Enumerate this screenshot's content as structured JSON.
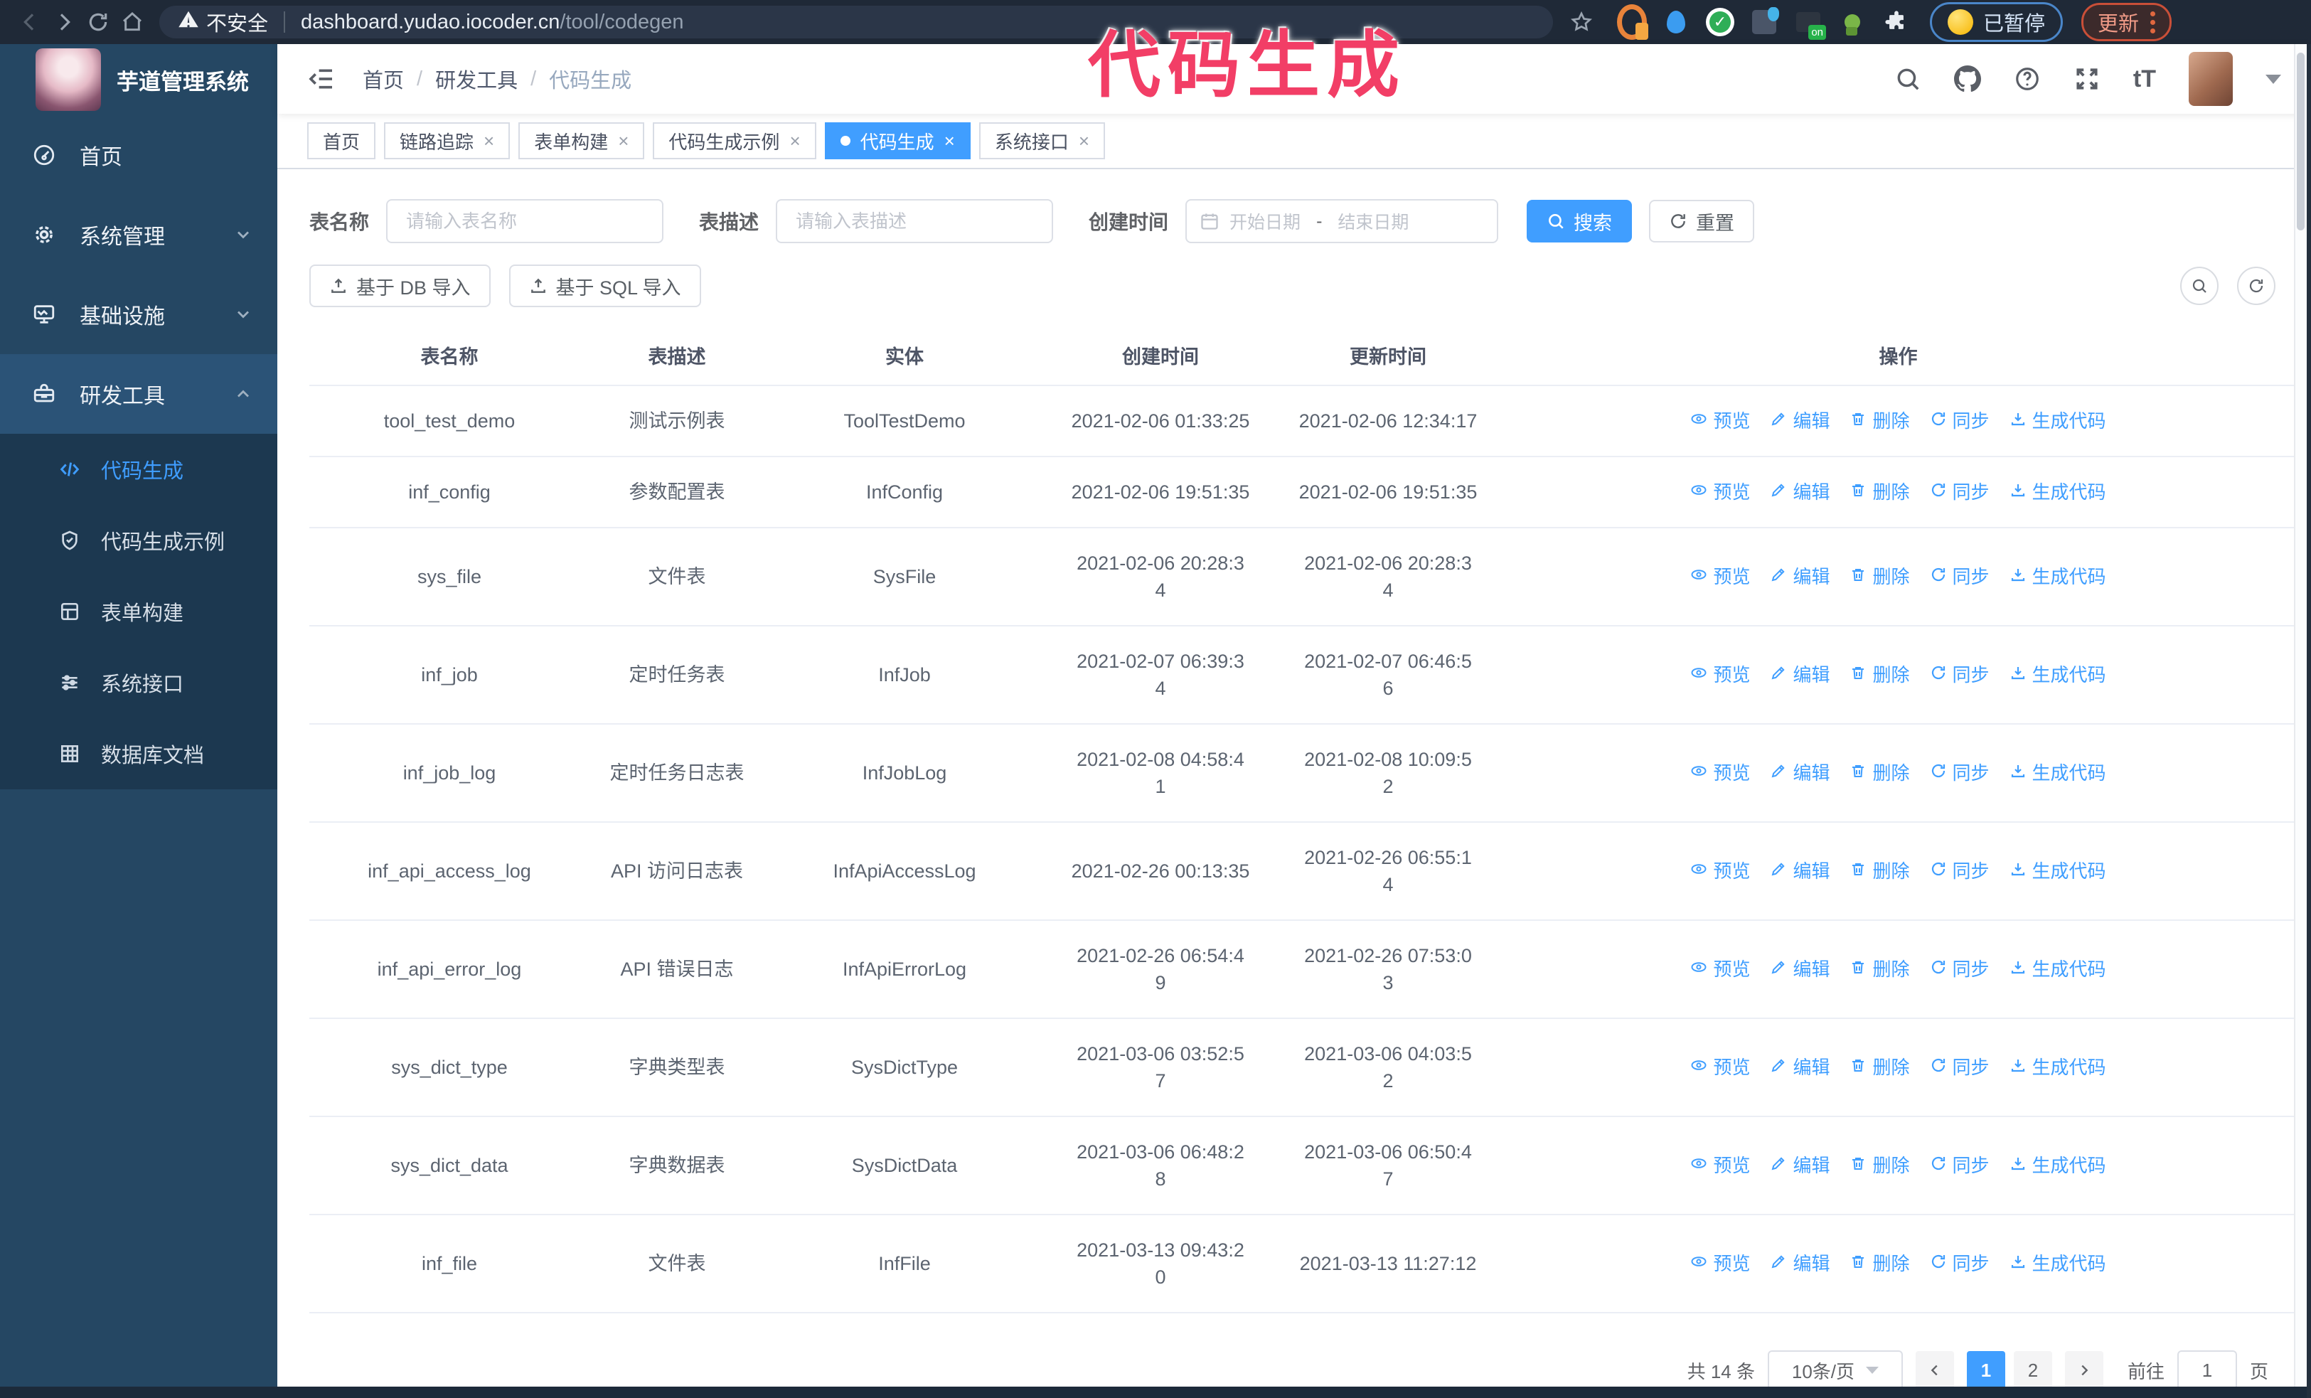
{
  "theme": {
    "accent": "#409EFF",
    "annotation_pink": "#F23E66",
    "sidebar_bg": "#254763",
    "submenu_bg": "#1C3850",
    "browser_bar": "#1F2937",
    "update_red": "#C94F38",
    "paused_blue": "#4A86C9",
    "link_blue": "#3F9EFF"
  },
  "browser": {
    "security_warning": "不安全",
    "url_host": "dashboard.yudao.iocoder.cn",
    "url_path": "/tool/codegen",
    "extension_on_label": "on",
    "paused_badge": "已暂停",
    "update_button": "更新"
  },
  "annotation": {
    "text": "代码生成"
  },
  "sidebar": {
    "logo_title": "芋道管理系统",
    "items": [
      {
        "label": "首页",
        "icon": "dashboard",
        "expandable": false,
        "expanded": false
      },
      {
        "label": "系统管理",
        "icon": "gear",
        "expandable": true,
        "expanded": false
      },
      {
        "label": "基础设施",
        "icon": "monitor",
        "expandable": true,
        "expanded": false
      },
      {
        "label": "研发工具",
        "icon": "toolbox",
        "expandable": true,
        "expanded": true
      }
    ],
    "submenu": [
      {
        "label": "代码生成",
        "icon": "code",
        "active": true
      },
      {
        "label": "代码生成示例",
        "icon": "shield-check",
        "active": false
      },
      {
        "label": "表单构建",
        "icon": "form",
        "active": false
      },
      {
        "label": "系统接口",
        "icon": "sliders",
        "active": false
      },
      {
        "label": "数据库文档",
        "icon": "db-doc",
        "active": false
      }
    ]
  },
  "header": {
    "breadcrumb": [
      "首页",
      "研发工具",
      "代码生成"
    ],
    "breadcrumb_separator": "/"
  },
  "tabs_meta": {
    "close": "×"
  },
  "tabs": [
    {
      "label": "首页",
      "closable": false,
      "active": false
    },
    {
      "label": "链路追踪",
      "closable": true,
      "active": false
    },
    {
      "label": "表单构建",
      "closable": true,
      "active": false
    },
    {
      "label": "代码生成示例",
      "closable": true,
      "active": false
    },
    {
      "label": "代码生成",
      "closable": true,
      "active": true
    },
    {
      "label": "系统接口",
      "closable": true,
      "active": false
    }
  ],
  "filters": {
    "table_name_label": "表名称",
    "table_name_placeholder": "请输入表名称",
    "table_desc_label": "表描述",
    "table_desc_placeholder": "请输入表描述",
    "create_time_label": "创建时间",
    "date_start_placeholder": "开始日期",
    "date_separator": "-",
    "date_end_placeholder": "结束日期",
    "search_button": "搜索",
    "reset_button": "重置"
  },
  "toolbar": {
    "import_db": "基于 DB 导入",
    "import_sql": "基于 SQL 导入"
  },
  "table": {
    "columns": [
      "表名称",
      "表描述",
      "实体",
      "创建时间",
      "更新时间",
      "操作"
    ],
    "actions": [
      "预览",
      "编辑",
      "删除",
      "同步",
      "生成代码"
    ],
    "rows": [
      {
        "name": "tool_test_demo",
        "desc": "测试示例表",
        "entity": "ToolTestDemo",
        "created": "2021-02-06 01:33:25",
        "updated": "2021-02-06 12:34:17"
      },
      {
        "name": "inf_config",
        "desc": "参数配置表",
        "entity": "InfConfig",
        "created": "2021-02-06 19:51:35",
        "updated": "2021-02-06 19:51:35"
      },
      {
        "name": "sys_file",
        "desc": "文件表",
        "entity": "SysFile",
        "created": "2021-02-06 20:28:3\n4",
        "updated": "2021-02-06 20:28:3\n4"
      },
      {
        "name": "inf_job",
        "desc": "定时任务表",
        "entity": "InfJob",
        "created": "2021-02-07 06:39:3\n4",
        "updated": "2021-02-07 06:46:5\n6"
      },
      {
        "name": "inf_job_log",
        "desc": "定时任务日志表",
        "entity": "InfJobLog",
        "created": "2021-02-08 04:58:4\n1",
        "updated": "2021-02-08 10:09:5\n2"
      },
      {
        "name": "inf_api_access_log",
        "desc": "API 访问日志表",
        "entity": "InfApiAccessLog",
        "created": "2021-02-26 00:13:35",
        "updated": "2021-02-26 06:55:1\n4"
      },
      {
        "name": "inf_api_error_log",
        "desc": "API 错误日志",
        "entity": "InfApiErrorLog",
        "created": "2021-02-26 06:54:4\n9",
        "updated": "2021-02-26 07:53:0\n3"
      },
      {
        "name": "sys_dict_type",
        "desc": "字典类型表",
        "entity": "SysDictType",
        "created": "2021-03-06 03:52:5\n7",
        "updated": "2021-03-06 04:03:5\n2"
      },
      {
        "name": "sys_dict_data",
        "desc": "字典数据表",
        "entity": "SysDictData",
        "created": "2021-03-06 06:48:2\n8",
        "updated": "2021-03-06 06:50:4\n7"
      },
      {
        "name": "inf_file",
        "desc": "文件表",
        "entity": "InfFile",
        "created": "2021-03-13 09:43:2\n0",
        "updated": "2021-03-13 11:27:12"
      }
    ]
  },
  "pagination": {
    "total": "共 14 条",
    "page_size": "10条/页",
    "pages": [
      "1",
      "2"
    ],
    "active_page": "1",
    "goto_label": "前往",
    "goto_value": "1",
    "goto_suffix": "页"
  },
  "icons": {
    "browser": [
      "back-icon",
      "forward-icon",
      "reload-icon",
      "home-icon",
      "warning-icon",
      "star-icon"
    ],
    "header": [
      "search-icon",
      "github-icon",
      "help-icon",
      "fullscreen-icon",
      "font-size-icon",
      "chevron-down-icon"
    ],
    "actions": [
      "eye-icon",
      "pencil-icon",
      "trash-icon",
      "sync-icon",
      "download-icon"
    ]
  }
}
